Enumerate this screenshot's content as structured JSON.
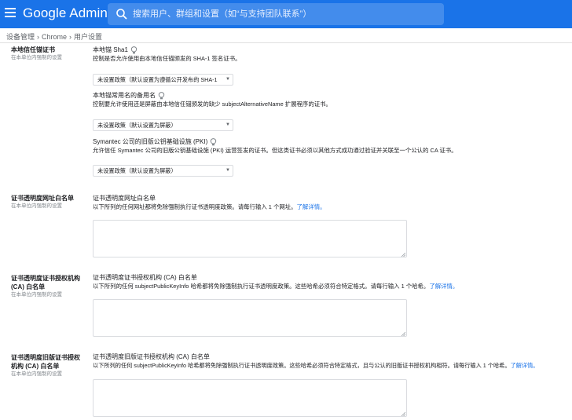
{
  "header": {
    "app_title": "Google Admin",
    "search_placeholder": "搜索用户、群组和设置（如“与支持团队联系”）",
    "brand_color": "#1a73e8"
  },
  "breadcrumb": [
    "设备管理",
    "Chrome",
    "用户设置"
  ],
  "sections": {
    "local_trust": {
      "title": "本地信任锚证书",
      "subtitle": "在本单位内强制的设置",
      "sha1": {
        "label": "本地锚 Sha1",
        "desc": "控制是否允许使用由本地信任锚颁发的 SHA-1 签名证书。",
        "select": "未设置政策（默认设置为遵循公开发布的 SHA-1"
      },
      "common_name": {
        "label": "本地锚常用名的备用名",
        "desc": "控制要允许使用还是屏蔽由本地信任锚颁发的缺少 subjectAlternativeName 扩展程序的证书。",
        "select": "未设置政策（默认设置为屏蔽）"
      },
      "symantec": {
        "label": "Symantec 公司的旧版公钥基础设施 (PKI)",
        "desc": "允许信任 Symantec 公司的旧版公钥基础设施 (PKI) 运营签发的证书。但这类证书必须以其他方式成功通过验证并关联至一个公认的 CA 证书。",
        "select": "未设置政策（默认设置为屏蔽）"
      }
    },
    "ct_url": {
      "title": "证书透明度网址白名单",
      "subtitle": "在本单位内强制的设置",
      "label": "证书透明度网址白名单",
      "desc": "以下所列的任何网址都将免除强制执行证书透明度政策。请每行输入 1 个网址。",
      "link": "了解详情。"
    },
    "ct_ca": {
      "title": "证书透明度证书授权机构 (CA) 白名单",
      "subtitle": "在本单位内强制的设置",
      "label": "证书透明度证书授权机构 (CA) 白名单",
      "desc": "以下所列的任何 subjectPublicKeyInfo 哈希都将免除强制执行证书透明度政策。这些哈希必须符合特定格式。请每行输入 1 个哈希。",
      "link": "了解详情。"
    },
    "ct_legacy": {
      "title": "证书透明度旧版证书授权机构 (CA) 白名单",
      "subtitle": "在本单位内强制的设置",
      "label": "证书透明度旧版证书授权机构 (CA) 白名单",
      "desc": "以下所列的任何 subjectPublicKeyInfo 哈希都将免除强制执行证书透明度政策。这些哈希必须符合特定格式，且与公认的旧版证书授权机构相符。请每行输入 1 个哈希。",
      "link": "了解详情。"
    }
  }
}
